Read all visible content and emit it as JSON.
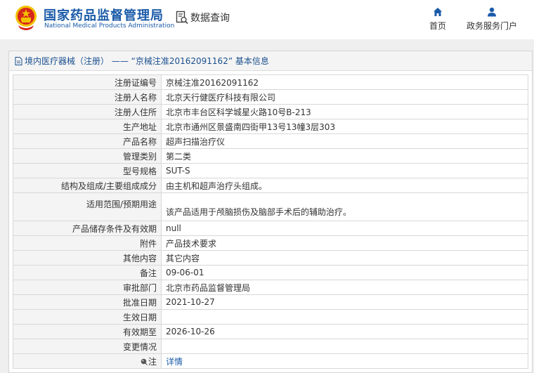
{
  "header": {
    "site_name_cn": "国家药品监督管理局",
    "site_name_en": "National Medical Products Administration",
    "data_query": "数据查询",
    "nav_home": "首页",
    "nav_portal": "政务服务门户"
  },
  "panel": {
    "title": "境内医疗器械（注册） —— “京械注准20162091162” 基本信息"
  },
  "rows": [
    {
      "label": "注册证编号",
      "value": "京械注准20162091162"
    },
    {
      "label": "注册人名称",
      "value": "北京天行健医疗科技有限公司"
    },
    {
      "label": "注册人住所",
      "value": "北京市丰台区科学城星火路10号B-213"
    },
    {
      "label": "生产地址",
      "value": "北京市通州区景盛南四街甲13号13幢3层303"
    },
    {
      "label": "产品名称",
      "value": "超声扫描治疗仪"
    },
    {
      "label": "管理类别",
      "value": "第二类"
    },
    {
      "label": "型号规格",
      "value": "SUT-S"
    },
    {
      "label": "结构及组成/主要组成成分",
      "value": "由主机和超声治疗头组成。"
    },
    {
      "label": "适用范围/预期用途",
      "value": "该产品适用于颅脑损伤及脑部手术后的辅助治疗。"
    },
    {
      "label": "产品储存条件及有效期",
      "value": "null"
    },
    {
      "label": "附件",
      "value": "产品技术要求"
    },
    {
      "label": "其他内容",
      "value": "其它内容"
    },
    {
      "label": "备注",
      "value": "09-06-01"
    },
    {
      "label": "审批部门",
      "value": "北京市药品监督管理局"
    },
    {
      "label": "批准日期",
      "value": "2021-10-27"
    },
    {
      "label": "生效日期",
      "value": ""
    },
    {
      "label": "有效期至",
      "value": "2026-10-26"
    },
    {
      "label": "变更情况",
      "value": ""
    },
    {
      "label": "注",
      "value": "详情"
    }
  ],
  "colors": {
    "brand_blue": "#1a5aa8",
    "emblem_red": "#d7261c",
    "emblem_gold": "#f2c200"
  },
  "icons": [
    "national-emblem-icon",
    "data-query-icon",
    "home-icon",
    "user-icon",
    "document-icon",
    "pin-icon"
  ]
}
